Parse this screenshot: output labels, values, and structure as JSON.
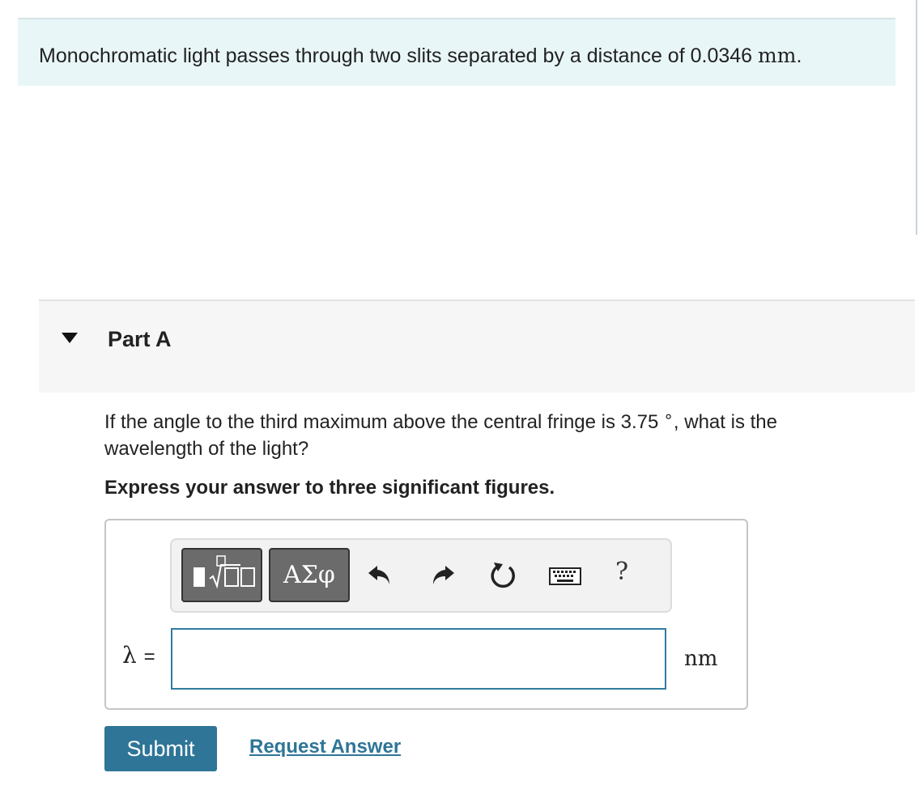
{
  "intro": {
    "text": "Monochromatic light passes through two slits separated by a distance of 0.0346 ",
    "unit": "mm",
    "end": "."
  },
  "part": {
    "title": "Part A",
    "toggle_icon": "triangle-down-icon"
  },
  "question": {
    "text_before": "If the angle to the third maximum above the central fringe is 3.75",
    "degree_symbol": "∘",
    "text_after": ", what is the wavelength of the light?"
  },
  "instruction": "Express your answer to three significant figures.",
  "toolbar": {
    "templates_icon": "templates-icon",
    "greek_label": "ΑΣφ",
    "undo_icon": "undo-icon",
    "redo_icon": "redo-icon",
    "reset_icon": "reset-icon",
    "keyboard_icon": "keyboard-icon",
    "help_label": "?"
  },
  "answer": {
    "variable": "λ",
    "equals": "=",
    "value": "",
    "unit": "nm"
  },
  "actions": {
    "submit_label": "Submit",
    "request_label": "Request Answer"
  },
  "colors": {
    "accent": "#2e7597",
    "intro_bg": "#e9f6f7",
    "part_bg": "#f6f6f6",
    "input_border": "#2f7ca0"
  }
}
